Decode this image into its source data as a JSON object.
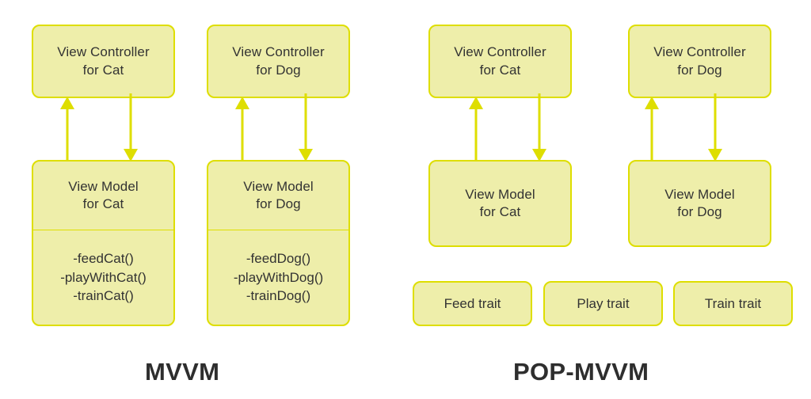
{
  "diagram": {
    "background_color": "#ffffff",
    "node_fill_color": "#eeeeaa",
    "node_border_color": "#dede00",
    "arrow_color": "#dede00",
    "text_color": "#333333",
    "caption_color": "#2e2e2e"
  },
  "left": {
    "caption": "MVVM",
    "columns": [
      {
        "view_controller": "View Controller\nfor Cat",
        "view_model": "View Model\nfor Cat",
        "members": [
          "-feedCat()",
          "-playWithCat()",
          "-trainCat()"
        ]
      },
      {
        "view_controller": "View Controller\nfor Dog",
        "view_model": "View Model\nfor Dog",
        "members": [
          "-feedDog()",
          "-playWithDog()",
          "-trainDog()"
        ]
      }
    ]
  },
  "right": {
    "caption": "POP-MVVM",
    "columns": [
      {
        "view_controller": "View Controller\nfor Cat",
        "view_model": "View Model\nfor Cat"
      },
      {
        "view_controller": "View Controller\nfor Dog",
        "view_model": "View Model\nfor Dog"
      }
    ],
    "traits": [
      "Feed trait",
      "Play trait",
      "Train trait"
    ]
  }
}
